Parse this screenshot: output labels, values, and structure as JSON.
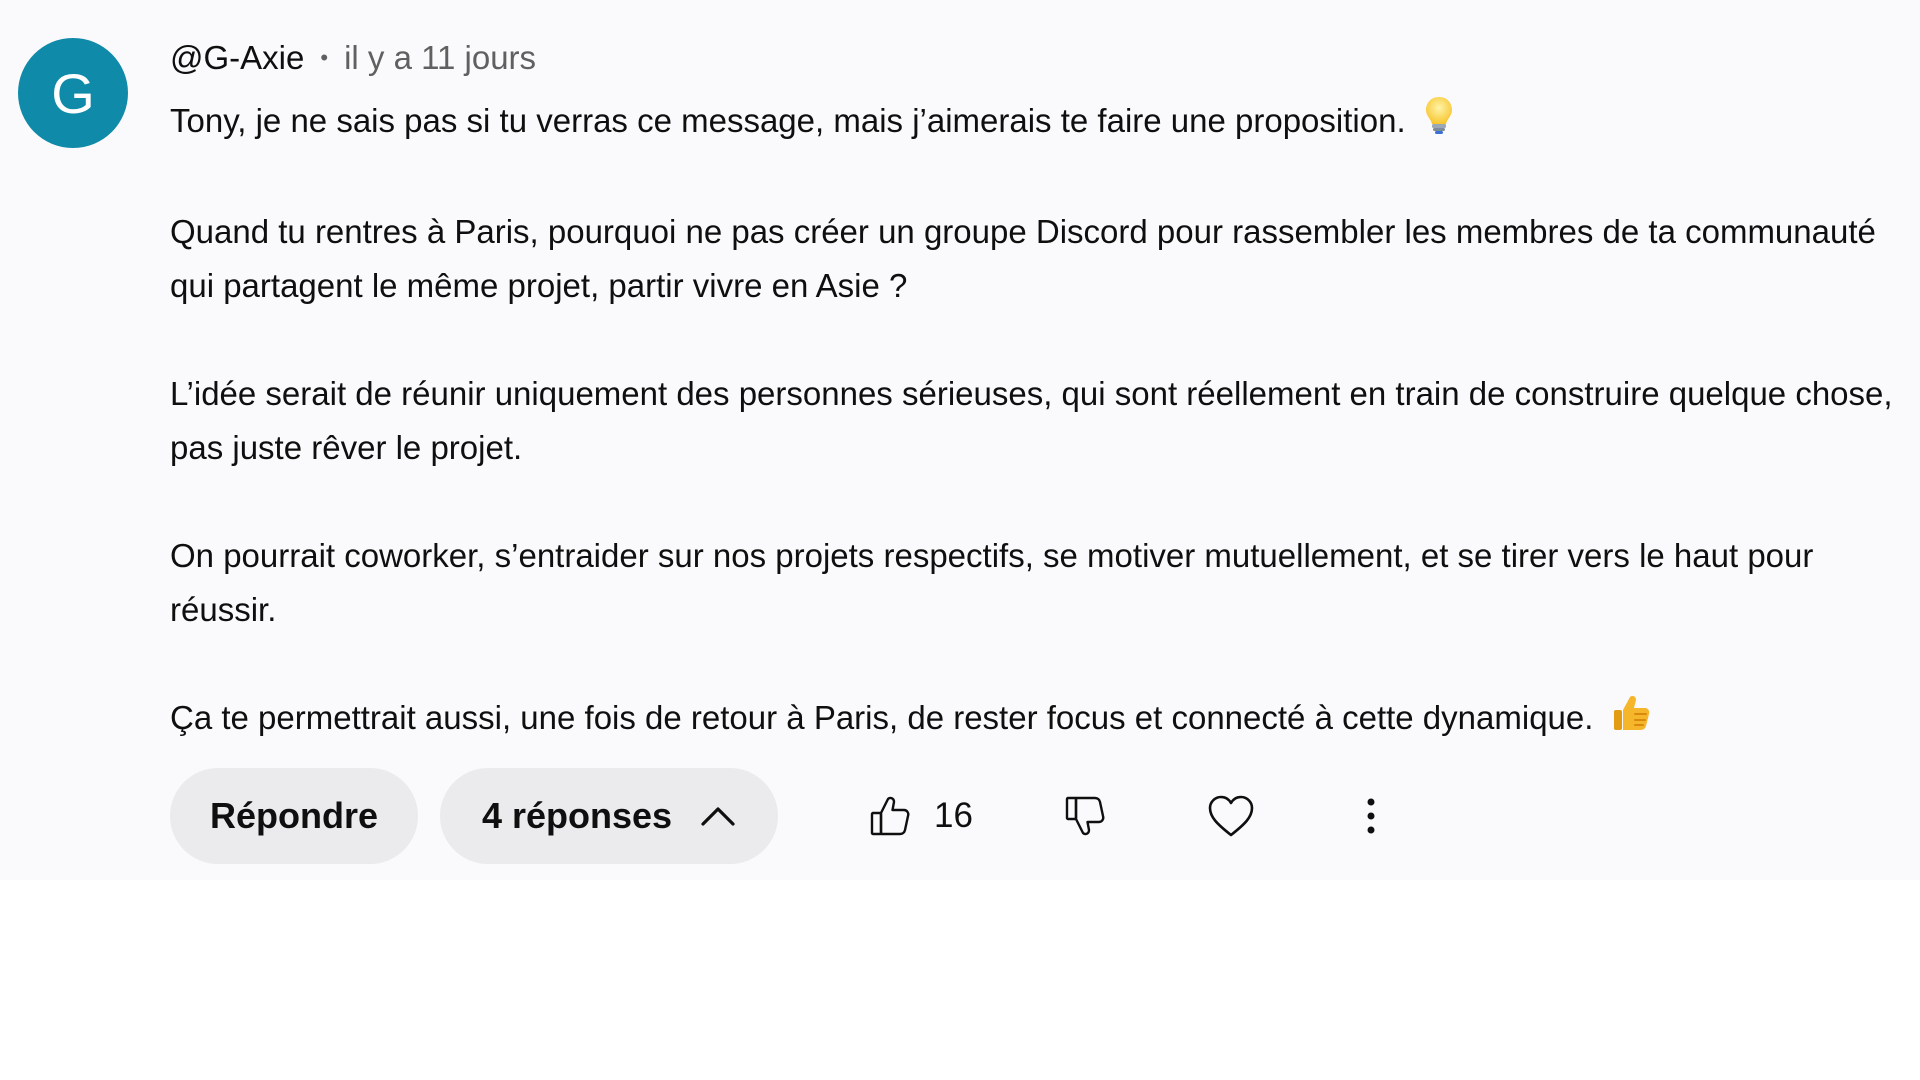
{
  "comment": {
    "avatar_letter": "G",
    "avatar_color": "#0f8aa8",
    "author": "@G-Axie",
    "separator": "•",
    "timestamp": "il y a 11 jours",
    "paragraphs": [
      "Tony, je ne sais pas si tu verras ce message, mais j’aimerais te faire une proposition.",
      "Quand tu rentres à Paris, pourquoi ne pas créer un groupe Discord pour rassembler les membres de ta communauté qui partagent le même projet, partir vivre en Asie ?",
      "L’idée serait de réunir uniquement des personnes sérieuses, qui sont réellement en train de construire quelque chose, pas juste rêver le projet.",
      "On pourrait coworker, s’entraider sur nos projets respectifs, se motiver mutuellement, et se tirer vers le haut pour réussir.",
      "Ça te permettrait aussi, une fois de retour à Paris, de rester focus et connecté à cette dynamique."
    ],
    "emojis": {
      "first_paragraph": "light-bulb-icon",
      "last_paragraph": "thumbs-up-emoji-icon"
    }
  },
  "actions": {
    "reply_label": "Répondre",
    "replies_label": "4 réponses",
    "like_count": "16",
    "icons": [
      "thumbs-up-icon",
      "thumbs-down-icon",
      "heart-icon",
      "more-vert-icon",
      "chevron-up-icon"
    ]
  }
}
